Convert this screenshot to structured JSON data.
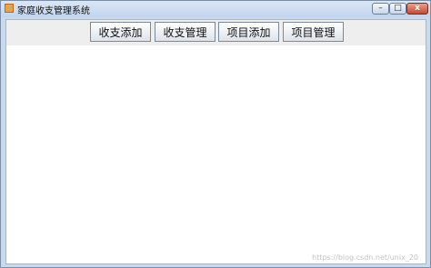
{
  "window": {
    "title": "家庭收支管理系统",
    "controls": {
      "minimize": "–",
      "maximize": "□",
      "close": "x"
    }
  },
  "toolbar": {
    "buttons": [
      {
        "label": "收支添加"
      },
      {
        "label": "收支管理"
      },
      {
        "label": "项目添加"
      },
      {
        "label": "项目管理"
      }
    ]
  },
  "watermark": "https://blog.csdn.net/unix_20",
  "colors": {
    "titlebar": "#c9d9ee",
    "toolbar_background": "#eeeeee",
    "close_button": "#c8482f"
  }
}
